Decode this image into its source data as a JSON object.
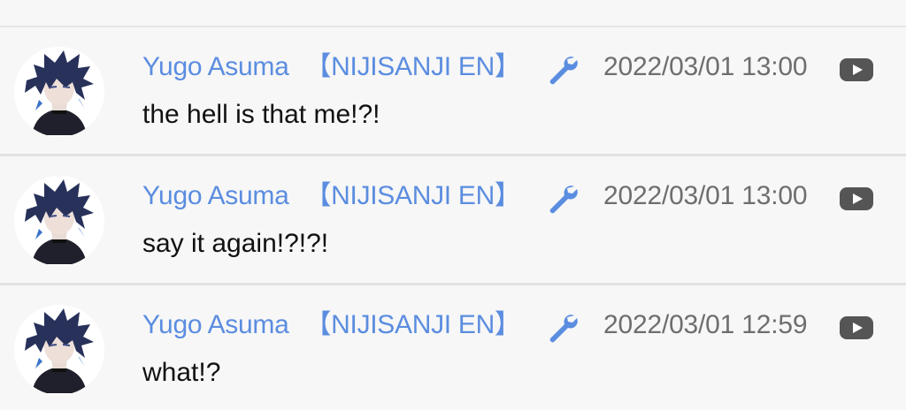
{
  "colors": {
    "author": "#5b8de0",
    "timestamp": "#6e6e6e",
    "message_text": "#111111",
    "background": "#f7f7f7"
  },
  "messages": [
    {
      "author": "Yugo Asuma",
      "tag": "【NIJISANJI EN】",
      "badge_icon": "wrench-icon",
      "timestamp": "2022/03/01 13:00",
      "source_icon": "youtube-icon",
      "text": "the hell is that me!?!"
    },
    {
      "author": "Yugo Asuma",
      "tag": "【NIJISANJI EN】",
      "badge_icon": "wrench-icon",
      "timestamp": "2022/03/01 13:00",
      "source_icon": "youtube-icon",
      "text": "say it again!?!?!"
    },
    {
      "author": "Yugo Asuma",
      "tag": "【NIJISANJI EN】",
      "badge_icon": "wrench-icon",
      "timestamp": "2022/03/01 12:59",
      "source_icon": "youtube-icon",
      "text": "what!?"
    }
  ]
}
